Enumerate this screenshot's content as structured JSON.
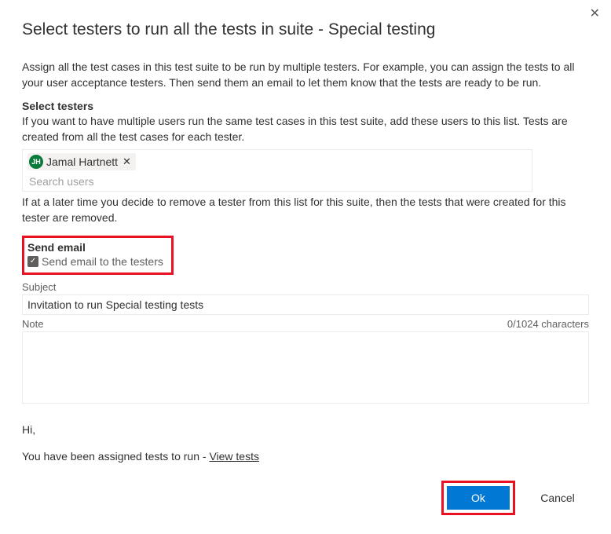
{
  "dialog": {
    "title": "Select testers to run all the tests in suite - Special testing",
    "close_icon": "✕"
  },
  "intro": "Assign all the test cases in this test suite to be run by multiple testers. For example, you can assign the tests to all your user acceptance testers. Then send them an email to let them know that the tests are ready to be run.",
  "select_testers": {
    "heading": "Select testers",
    "subtext": "If you want to have multiple users run the same test cases in this test suite, add these users to this list. Tests are created from all the test cases for each tester.",
    "chip": {
      "initials": "JH",
      "name": "Jamal Hartnett"
    },
    "search_placeholder": "Search users",
    "after_note": "If at a later time you decide to remove a tester from this list for this suite, then the tests that were created for this tester are removed."
  },
  "send_email": {
    "heading": "Send email",
    "checkbox_label": "Send email to the testers",
    "checked": true,
    "subject_label": "Subject",
    "subject_value": "Invitation to run Special testing tests",
    "note_label": "Note",
    "char_counter": "0/1024 characters"
  },
  "preview": {
    "greeting": "Hi,",
    "assigned_text": "You have been assigned tests to run - ",
    "link_text": "View tests"
  },
  "buttons": {
    "ok": "Ok",
    "cancel": "Cancel"
  }
}
